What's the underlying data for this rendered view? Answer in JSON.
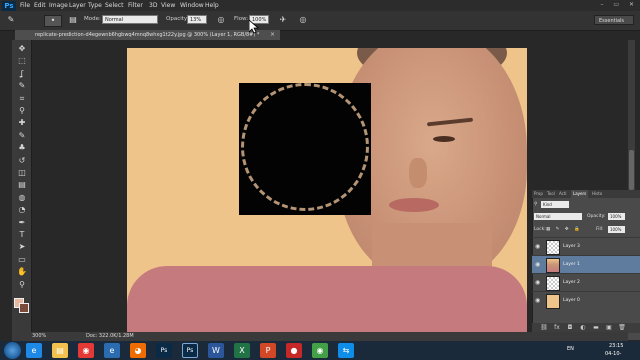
{
  "app": {
    "logo": "Ps"
  },
  "menu": [
    "File",
    "Edit",
    "Image",
    "Layer",
    "Type",
    "Select",
    "Filter",
    "3D",
    "View",
    "Window",
    "Help"
  ],
  "window_controls": "–  ▭  ✕",
  "options": {
    "mode_label": "Mode:",
    "mode_value": "Normal",
    "opacity_label": "Opacity:",
    "opacity_value": "13%",
    "flow_label": "Flow:",
    "flow_value": "100%",
    "workspace": "Essentials"
  },
  "document_tab": {
    "title": "replicate-prediction-d4egewnb6hgbwq4mnq8whxg1t22y.jpg @ 300% (Layer 1, RGB/8#) *",
    "close": "×"
  },
  "tools": [
    "move-icon",
    "marquee-icon",
    "lasso-icon",
    "quick-select-icon",
    "crop-icon",
    "eyedropper-icon",
    "healing-icon",
    "brush-icon",
    "clone-stamp-icon",
    "history-brush-icon",
    "eraser-icon",
    "gradient-icon",
    "blur-icon",
    "dodge-icon",
    "pen-icon",
    "type-icon",
    "path-select-icon",
    "shape-icon",
    "hand-icon",
    "zoom-icon"
  ],
  "tool_glyphs": [
    "✥",
    "⬚",
    "ʆ",
    "✎",
    "⌗",
    "⚲",
    "✚",
    "✎",
    "♣",
    "↺",
    "◫",
    "▤",
    "◍",
    "◔",
    "✒",
    "T",
    "➤",
    "▭",
    "✋",
    "⚲"
  ],
  "colors": {
    "foreground": "#e6b9a0",
    "background": "#7a4a3a",
    "accent": "#31a8ff",
    "selection": "#5f7b9d"
  },
  "status": {
    "zoom": "300%",
    "doc": "Doc: 322.0K/1.28M"
  },
  "layers_panel": {
    "tabs": [
      "Prop",
      "Tool",
      "Acti",
      "Layers",
      "Histo"
    ],
    "kind_label": "Kind",
    "blend_mode": "Normal",
    "opacity_label": "Opacity:",
    "opacity_value": "100%",
    "lock_label": "Lock:",
    "fill_label": "Fill:",
    "fill_value": "100%",
    "layers": [
      {
        "name": "Layer 3",
        "selected": false
      },
      {
        "name": "Layer 1",
        "selected": true
      },
      {
        "name": "Layer 2",
        "selected": false
      },
      {
        "name": "Layer 0",
        "selected": false
      }
    ],
    "footer_icons": [
      "link-icon",
      "fx-icon",
      "mask-icon",
      "adjustment-icon",
      "group-icon",
      "new-layer-icon",
      "delete-icon"
    ],
    "footer_glyphs": [
      "⛓",
      "fx",
      "◘",
      "◐",
      "▬",
      "▣",
      "🗑"
    ]
  },
  "taskbar": {
    "apps": [
      "ie-icon",
      "explorer-icon",
      "chrome-icon",
      "edge-icon",
      "firefox-icon",
      "photoshop-icon",
      "photoshop-icon-2",
      "word-icon",
      "excel-icon",
      "powerpoint-icon",
      "record-icon",
      "chrome-icon-2",
      "teamviewer-icon"
    ],
    "lang": "EN",
    "time": "23:15",
    "date": "04-10-"
  }
}
